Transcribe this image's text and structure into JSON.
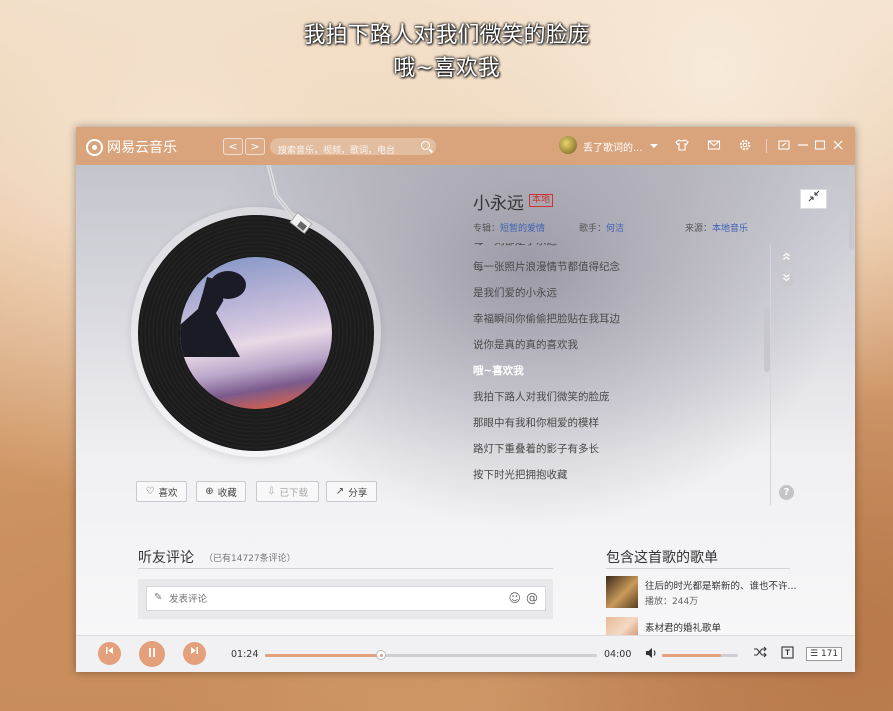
{
  "desktop_lyrics": {
    "line1": "我拍下路人对我们微笑的脸庞",
    "line2": "哦~喜欢我"
  },
  "app": {
    "name": "网易云音乐"
  },
  "titlebar": {
    "back": "<",
    "forward": ">",
    "search_placeholder": "搜索音乐，视频，歌词，电台",
    "username": "丢了歌词的..."
  },
  "song": {
    "title": "小永远",
    "tag": "本地",
    "album_label": "专辑：",
    "album": "短暂的爱情",
    "singer_label": "歌手：",
    "singer": "何洁",
    "source_label": "来源：",
    "source": "本地音乐"
  },
  "lyrics": [
    {
      "text": "每一刻都是小永远",
      "current": false
    },
    {
      "text": "每一张照片浪漫情节都值得纪念",
      "current": false
    },
    {
      "text": "是我们爱的小永远",
      "current": false
    },
    {
      "text": "幸福瞬间你偷偷把脸贴在我耳边",
      "current": false
    },
    {
      "text": "说你是真的真的喜欢我",
      "current": false
    },
    {
      "text": "哦~喜欢我",
      "current": true
    },
    {
      "text": "我拍下路人对我们微笑的脸庞",
      "current": false
    },
    {
      "text": "那眼中有我和你相爱的模样",
      "current": false
    },
    {
      "text": "路灯下重叠着的影子有多长",
      "current": false
    },
    {
      "text": "按下时光把拥抱收藏",
      "current": false
    }
  ],
  "actions": {
    "like": "喜欢",
    "collect": "收藏",
    "downloaded": "已下载",
    "share": "分享"
  },
  "comments": {
    "title": "听友评论",
    "count": "（已有14727条评论）",
    "placeholder": "发表评论"
  },
  "playlists": {
    "title": "包含这首歌的歌单",
    "items": [
      {
        "name": "往后的时光都是崭新的、谁也不许...",
        "plays": "播放：244万"
      },
      {
        "name": "素材君的婚礼歌单",
        "plays": ""
      }
    ]
  },
  "player": {
    "current_time": "01:24",
    "total_time": "04:00",
    "progress": 0.35,
    "volume": 0.78,
    "playlist_count": "171"
  },
  "colors": {
    "accent": "#e3a07a",
    "titlebar": "#d9a47c",
    "link": "#3c64b4",
    "tag": "#cc3333"
  }
}
